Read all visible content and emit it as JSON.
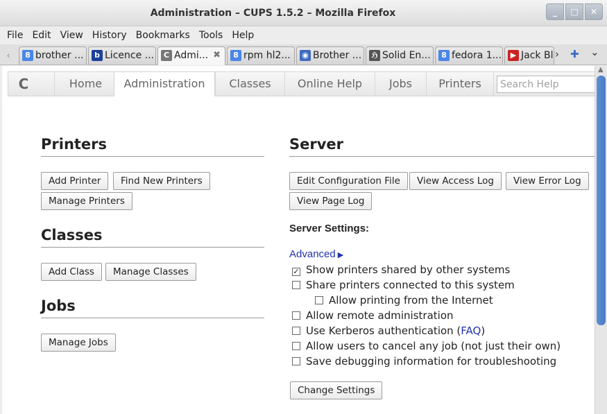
{
  "window": {
    "title": "Administration – CUPS 1.5.2 – Mozilla Firefox",
    "controls": {
      "minimize": "_",
      "maximize": "□",
      "close": "✕"
    }
  },
  "menubar": {
    "items": [
      "File",
      "Edit",
      "View",
      "History",
      "Bookmarks",
      "Tools",
      "Help"
    ]
  },
  "tabs": [
    {
      "label": "brother ...",
      "icon": "google-icon",
      "icon_glyph": "8",
      "icon_color": "#4a86e8"
    },
    {
      "label": "Licence ...",
      "icon": "brother-icon",
      "icon_glyph": "b",
      "icon_color": "#1a3f9b"
    },
    {
      "label": "Admi...",
      "icon": "cups-icon",
      "icon_glyph": "C",
      "icon_color": "#777777",
      "active": true,
      "close": "✖"
    },
    {
      "label": "rpm hl2...",
      "icon": "google-icon",
      "icon_glyph": "8",
      "icon_color": "#4a86e8"
    },
    {
      "label": "Brother ...",
      "icon": "brother-globe-icon",
      "icon_glyph": "◉",
      "icon_color": "#3d6cc0"
    },
    {
      "label": "Solid En...",
      "icon": "gothic-h-icon",
      "icon_glyph": "ℌ",
      "icon_color": "#555555"
    },
    {
      "label": "fedora 1...",
      "icon": "google-icon",
      "icon_glyph": "8",
      "icon_color": "#4a86e8"
    },
    {
      "label": "Jack Bl",
      "icon": "youtube-icon",
      "icon_glyph": "▶",
      "icon_color": "#cc2222"
    }
  ],
  "tabstrip": {
    "scroll_left": "‹",
    "scroll_right": "›",
    "new_tab": "✚",
    "list_all": "⌄"
  },
  "cups_nav": {
    "logo": "C",
    "links": [
      "Home",
      "Administration",
      "Classes",
      "Online Help",
      "Jobs",
      "Printers"
    ],
    "active": "Administration",
    "search_placeholder": "Search Help"
  },
  "printers": {
    "heading": "Printers",
    "buttons": [
      "Add Printer",
      "Find New Printers",
      "Manage Printers"
    ]
  },
  "classes": {
    "heading": "Classes",
    "buttons": [
      "Add Class",
      "Manage Classes"
    ]
  },
  "jobs": {
    "heading": "Jobs",
    "buttons": [
      "Manage Jobs"
    ]
  },
  "server": {
    "heading": "Server",
    "buttons": [
      "Edit Configuration File",
      "View Access Log",
      "View Error Log",
      "View Page Log"
    ],
    "settings_title": "Server Settings:",
    "advanced_label": "Advanced",
    "advanced_arrow": "▶",
    "options": [
      {
        "label": "Show printers shared by other systems",
        "checked": true
      },
      {
        "label": "Share printers connected to this system",
        "checked": false
      },
      {
        "label": "Allow printing from the Internet",
        "checked": false
      },
      {
        "label": "Allow remote administration",
        "checked": false
      },
      {
        "label": "Use Kerberos authentication (",
        "link": "FAQ",
        "suffix": ")",
        "checked": false
      },
      {
        "label": "Allow users to cancel any job (not just their own)",
        "checked": false
      },
      {
        "label": "Save debugging information for troubleshooting",
        "checked": false
      }
    ],
    "change_button": "Change Settings"
  },
  "colors": {
    "link": "#2233aa",
    "scroll_thumb": "#4a7bc5"
  }
}
